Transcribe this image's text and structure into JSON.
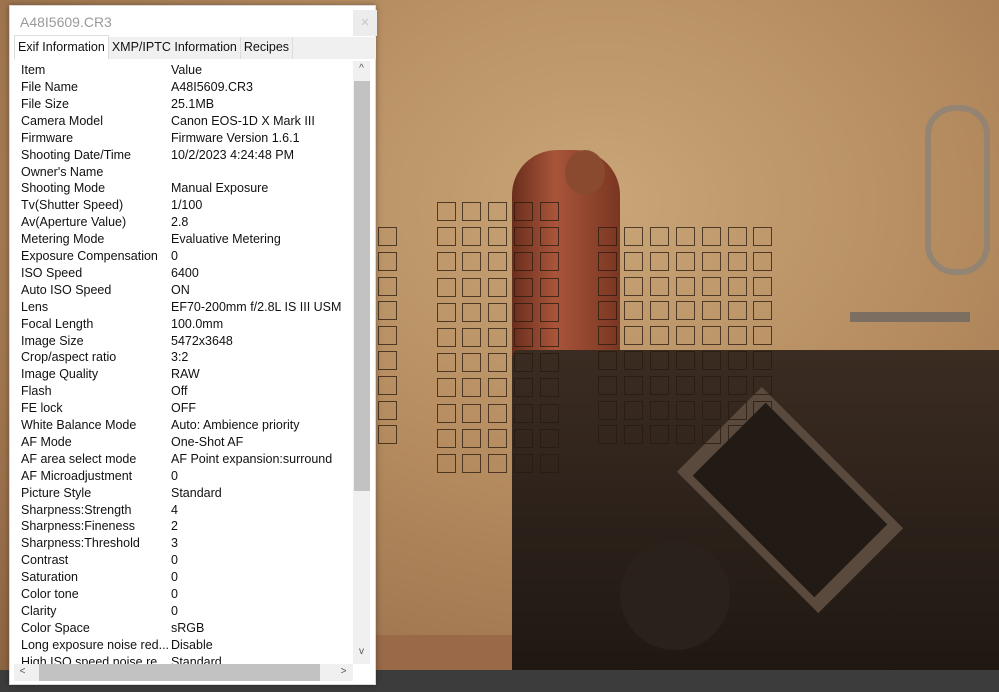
{
  "window": {
    "title": "A48I5609.CR3",
    "close_icon": "close-icon"
  },
  "tabs": [
    {
      "label": "Exif Information",
      "active": true
    },
    {
      "label": "XMP/IPTC Information"
    },
    {
      "label": "Recipes"
    }
  ],
  "columns": {
    "item": "Item",
    "value": "Value"
  },
  "rows": [
    {
      "k": "File Name",
      "v": "A48I5609.CR3"
    },
    {
      "k": "File Size",
      "v": "25.1MB"
    },
    {
      "k": "Camera Model",
      "v": "Canon EOS-1D X Mark III"
    },
    {
      "k": "Firmware",
      "v": "Firmware Version 1.6.1"
    },
    {
      "k": "Shooting Date/Time",
      "v": "10/2/2023 4:24:48 PM"
    },
    {
      "k": "Owner's Name",
      "v": ""
    },
    {
      "k": "Shooting Mode",
      "v": "Manual Exposure"
    },
    {
      "k": "Tv(Shutter Speed)",
      "v": "1/100"
    },
    {
      "k": "Av(Aperture Value)",
      "v": "2.8"
    },
    {
      "k": "Metering Mode",
      "v": "Evaluative Metering"
    },
    {
      "k": "Exposure Compensation",
      "v": "0"
    },
    {
      "k": "ISO Speed",
      "v": "6400"
    },
    {
      "k": "Auto ISO Speed",
      "v": "ON"
    },
    {
      "k": "Lens",
      "v": "EF70-200mm f/2.8L IS III USM"
    },
    {
      "k": "Focal Length",
      "v": "100.0mm"
    },
    {
      "k": "Image Size",
      "v": "5472x3648"
    },
    {
      "k": "Crop/aspect ratio",
      "v": "3:2"
    },
    {
      "k": "Image Quality",
      "v": "RAW"
    },
    {
      "k": "Flash",
      "v": "Off"
    },
    {
      "k": "FE lock",
      "v": "OFF"
    },
    {
      "k": "White Balance Mode",
      "v": "Auto: Ambience priority"
    },
    {
      "k": "AF Mode",
      "v": "One-Shot AF"
    },
    {
      "k": "AF area select mode",
      "v": "AF Point expansion:surround"
    },
    {
      "k": "AF Microadjustment",
      "v": "0"
    },
    {
      "k": "Picture Style",
      "v": "Standard"
    },
    {
      "k": "Sharpness:Strength",
      "v": "4"
    },
    {
      "k": "Sharpness:Fineness",
      "v": "2"
    },
    {
      "k": "Sharpness:Threshold",
      "v": "3"
    },
    {
      "k": "Contrast",
      "v": "0"
    },
    {
      "k": "Saturation",
      "v": "0"
    },
    {
      "k": "Color tone",
      "v": "0"
    },
    {
      "k": "Clarity",
      "v": "0"
    },
    {
      "k": "Color Space",
      "v": "sRGB"
    },
    {
      "k": "Long exposure noise red...",
      "v": "Disable"
    },
    {
      "k": "High ISO speed noise re...",
      "v": "Standard"
    }
  ],
  "scroll": {
    "up": "^",
    "down": "v",
    "left": "<",
    "right": ">"
  }
}
